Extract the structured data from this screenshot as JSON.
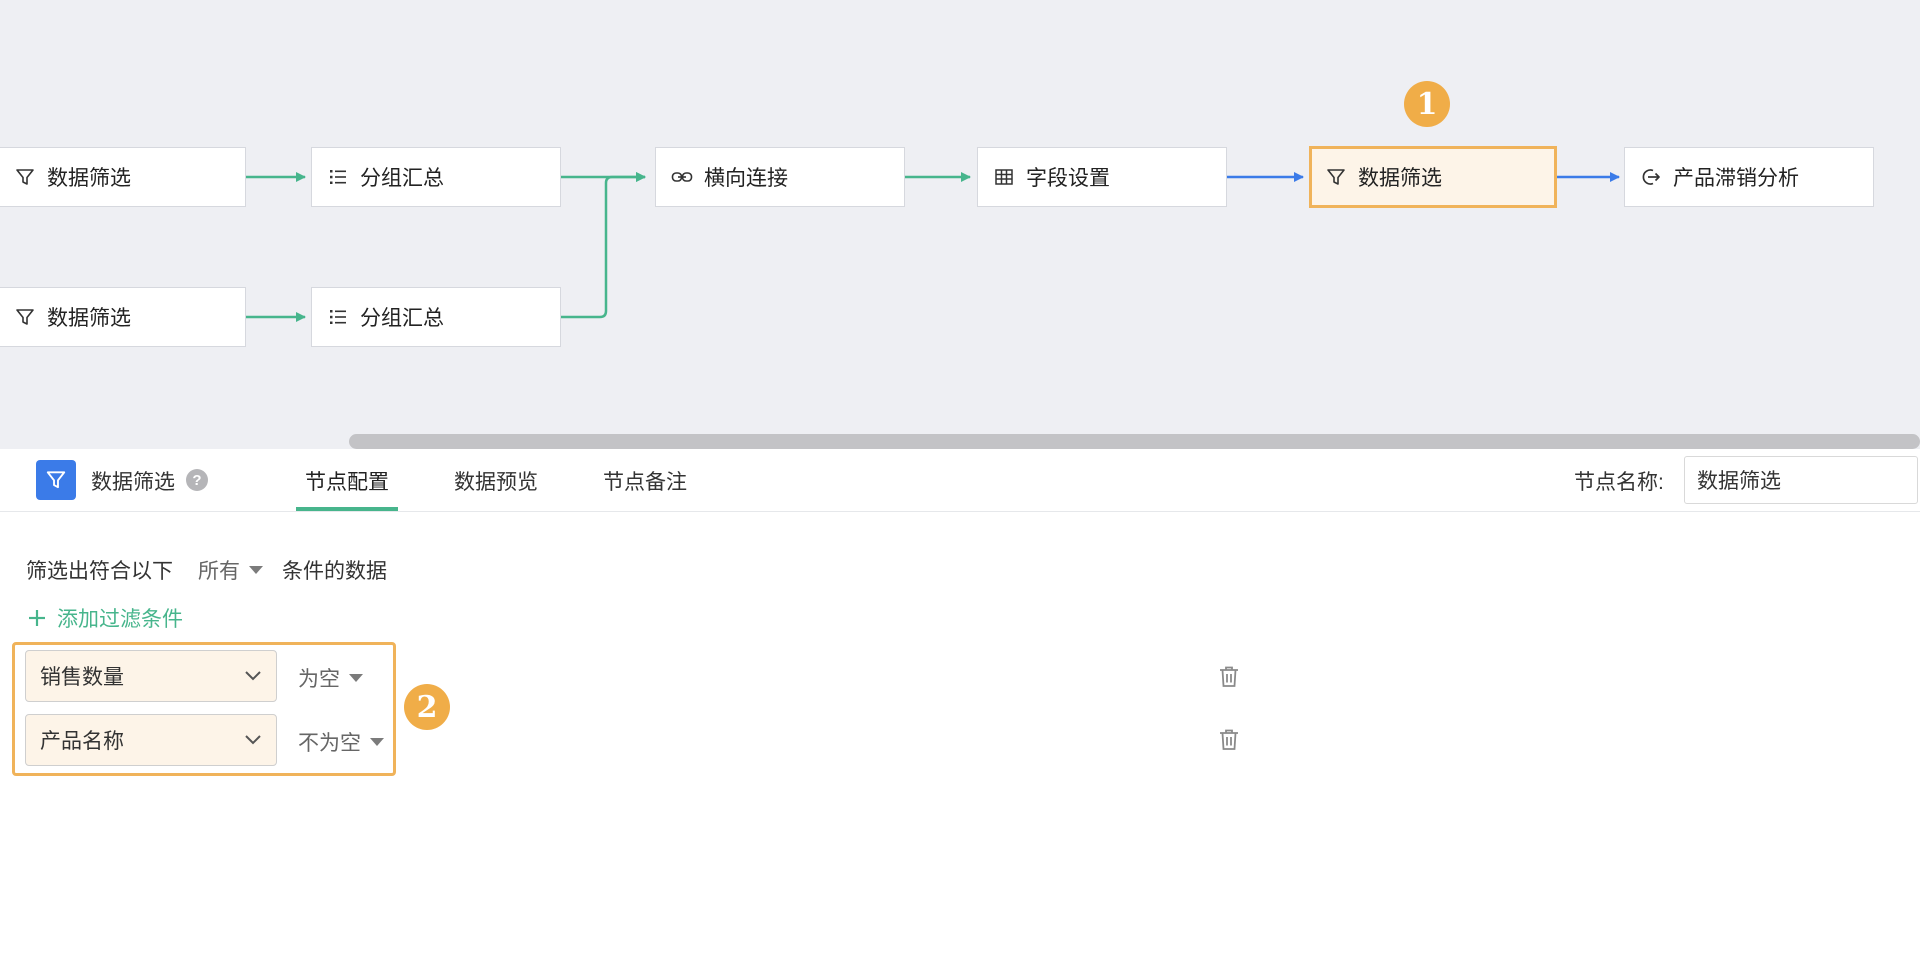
{
  "flow": {
    "nodes": [
      {
        "id": "filter-1",
        "label": "数据筛选",
        "icon": "filter-icon"
      },
      {
        "id": "groupsum-1",
        "label": "分组汇总",
        "icon": "list-icon"
      },
      {
        "id": "join",
        "label": "横向连接",
        "icon": "link-icon"
      },
      {
        "id": "field-settings",
        "label": "字段设置",
        "icon": "table-icon"
      },
      {
        "id": "filter-selected",
        "label": "数据筛选",
        "icon": "filter-icon"
      },
      {
        "id": "output",
        "label": "产品滞销分析",
        "icon": "output-icon"
      },
      {
        "id": "filter-2",
        "label": "数据筛选",
        "icon": "filter-icon"
      },
      {
        "id": "groupsum-2",
        "label": "分组汇总",
        "icon": "list-icon"
      }
    ],
    "badge_1": "1",
    "badge_2": "2",
    "colors": {
      "edge": "#47b58c",
      "edge_active": "#3b7be8",
      "highlight": "#f0b35a"
    }
  },
  "panel": {
    "title": "数据筛选",
    "help": "?",
    "tabs": [
      "节点配置",
      "数据预览",
      "节点备注"
    ],
    "active_tab": "节点配置",
    "node_name_label": "节点名称:",
    "node_name_value": "数据筛选"
  },
  "filter": {
    "prefix": "筛选出符合以下",
    "mode": "所有",
    "suffix": "条件的数据",
    "add_label": "添加过滤条件",
    "conditions": [
      {
        "field": "销售数量",
        "operator": "为空"
      },
      {
        "field": "产品名称",
        "operator": "不为空"
      }
    ]
  }
}
